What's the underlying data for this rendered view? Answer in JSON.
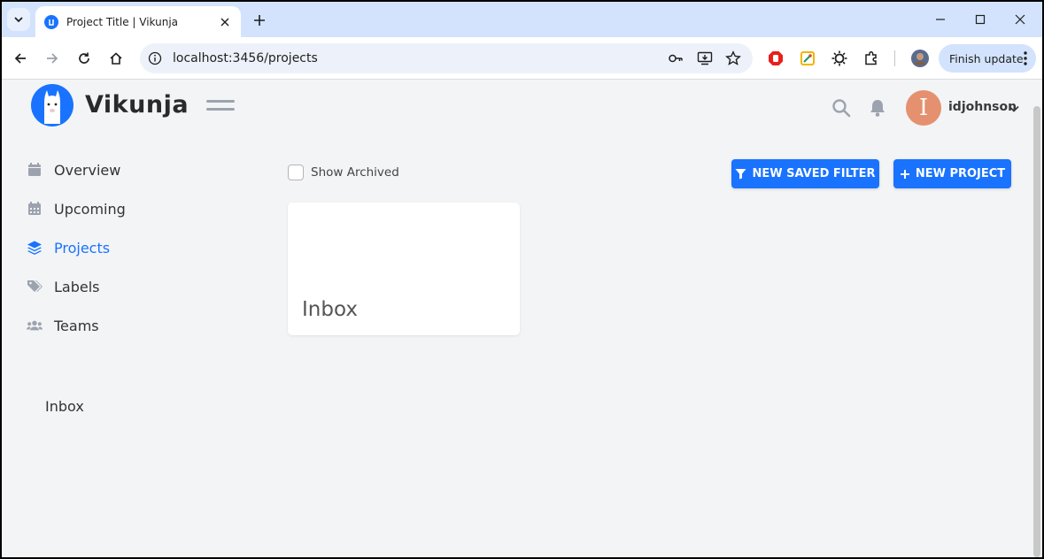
{
  "browser": {
    "tab_title": "Project Title | Vikunja",
    "url": "localhost:3456/projects",
    "finish_update_label": "Finish update"
  },
  "app": {
    "logo_text": "Vikunja",
    "username": "idjohnson",
    "avatar_initial": "I",
    "accent_color": "#1973ff"
  },
  "sidebar": {
    "items": [
      {
        "label": "Overview",
        "icon": "calendar-icon"
      },
      {
        "label": "Upcoming",
        "icon": "calendar-grid-icon"
      },
      {
        "label": "Projects",
        "icon": "layers-icon",
        "active": true
      },
      {
        "label": "Labels",
        "icon": "tags-icon"
      },
      {
        "label": "Teams",
        "icon": "users-icon"
      }
    ],
    "favorite_project": "Inbox"
  },
  "main": {
    "show_archived_label": "Show Archived",
    "new_saved_filter_label": "NEW SAVED FILTER",
    "new_project_label": "NEW PROJECT",
    "projects": [
      {
        "title": "Inbox"
      }
    ]
  }
}
